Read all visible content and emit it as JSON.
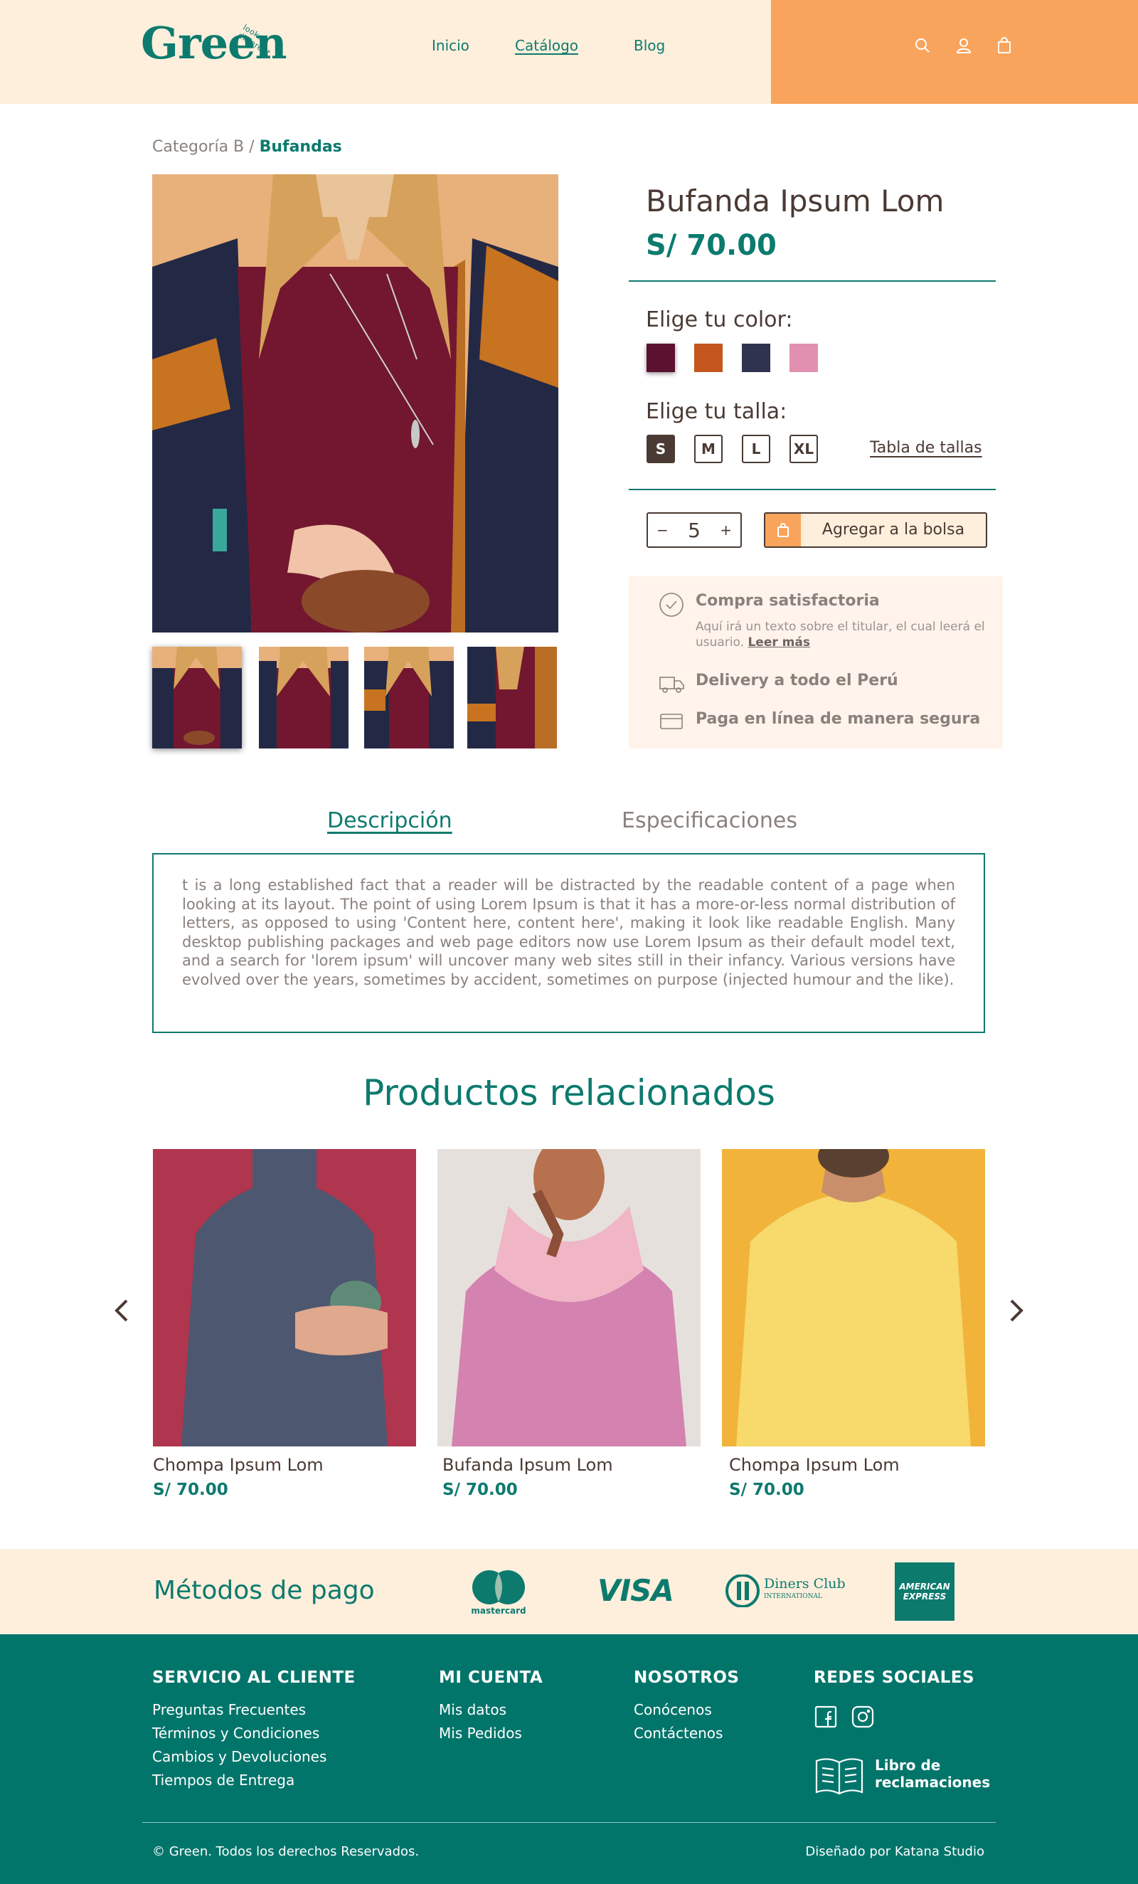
{
  "header": {
    "logo": "Green",
    "logo_tagline": "looks different",
    "nav": [
      "Inicio",
      "Catálogo",
      "Blog"
    ]
  },
  "breadcrumb": {
    "parent": "Categoría B / ",
    "current": "Bufandas"
  },
  "product": {
    "title": "Bufanda Ipsum Lom",
    "price": "S/ 70.00",
    "color_label": "Elige tu color:",
    "colors": [
      "#5a1230",
      "#c4561e",
      "#2f3350",
      "#e290b0"
    ],
    "size_label": "Elige tu talla:",
    "sizes": [
      "S",
      "M",
      "L",
      "XL"
    ],
    "selected_size": "S",
    "size_chart_link": "Tabla de tallas",
    "quantity": "5",
    "qty_minus": "−",
    "qty_plus": "+",
    "add_to_bag": "Agregar a la bolsa"
  },
  "benefits": {
    "satisfaction_title": "Compra satisfactoria",
    "satisfaction_text": "Aquí irá un texto sobre el titular, el cual leerá el usuario.",
    "read_more": "Leer más",
    "delivery": "Delivery a todo el Perú",
    "payment": "Paga en línea de manera segura"
  },
  "tabs": {
    "description": "Descripción",
    "specs": "Especificaciones"
  },
  "description_text": "t is a long established fact that a reader will be distracted by the readable content of a page when looking at its layout. The point of using Lorem Ipsum is that it has a more-or-less normal distribution of letters, as opposed to using 'Content here, content here', making it look like readable English. Many desktop publishing packages and web page editors now use Lorem Ipsum as their default model text, and a search for 'lorem ipsum' will uncover many web sites still in their infancy. Various versions have evolved over the years, sometimes by accident, sometimes on purpose (injected humour and the like).",
  "related": {
    "title": "Productos relacionados",
    "items": [
      {
        "name": "Chompa Ipsum Lom",
        "price": "S/ 70.00"
      },
      {
        "name": "Bufanda Ipsum Lom",
        "price": "S/ 70.00"
      },
      {
        "name": "Chompa Ipsum Lom",
        "price": "S/ 70.00"
      }
    ]
  },
  "payment": {
    "title": "Métodos de pago",
    "mastercard": "mastercard",
    "visa": "VISA",
    "diners": "Diners Club",
    "diners_sub": "INTERNATIONAL",
    "amex_1": "AMERICAN",
    "amex_2": "EXPRESS"
  },
  "footer": {
    "service_title": "SERVICIO AL CLIENTE",
    "service_links": [
      "Preguntas Frecuentes",
      "Términos y Condiciones",
      "Cambios y Devoluciones",
      "Tiempos de Entrega"
    ],
    "account_title": "MI CUENTA",
    "account_links": [
      "Mis datos",
      "Mis Pedidos"
    ],
    "us_title": "NOSOTROS",
    "us_links": [
      "Conócenos",
      "Contáctenos"
    ],
    "social_title": "REDES SOCIALES",
    "complaints_book": "Libro de reclamaciones",
    "copyright": "© Green. Todos los derechos Reservados.",
    "designer": "Diseñado por Katana Studio"
  },
  "colors": {
    "brand_green": "#0d7a6e",
    "orange": "#f9a45c",
    "cream": "#fdefdc",
    "footer_green": "#02756b"
  }
}
